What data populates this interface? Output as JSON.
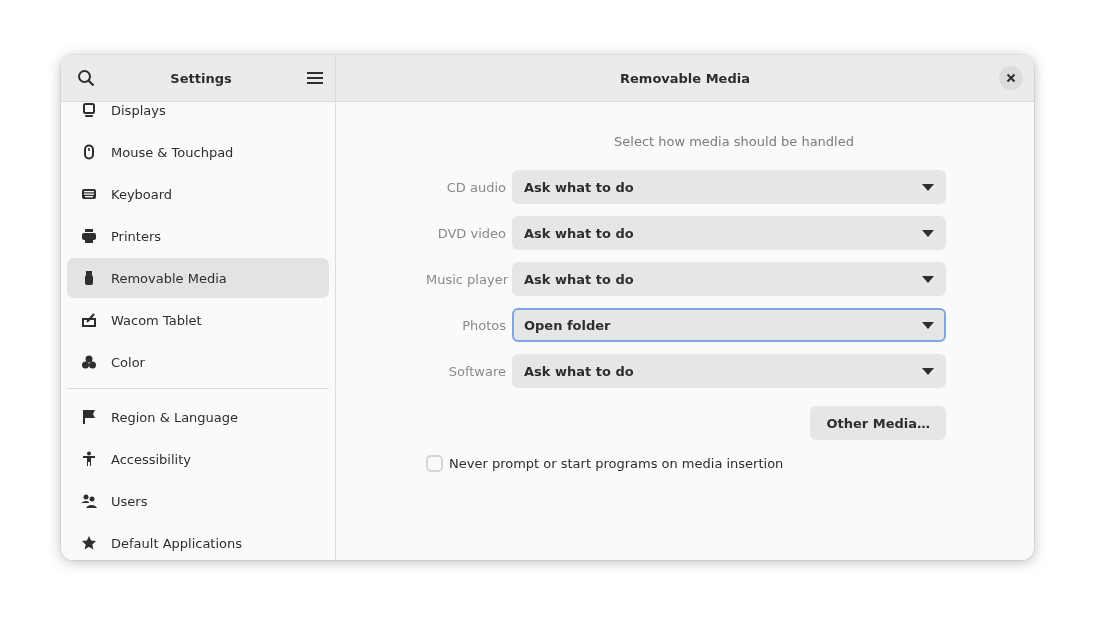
{
  "sidebar": {
    "title": "Settings",
    "groups": [
      {
        "items": [
          {
            "label": "Displays",
            "selected": false
          },
          {
            "label": "Mouse & Touchpad",
            "selected": false
          },
          {
            "label": "Keyboard",
            "selected": false
          },
          {
            "label": "Printers",
            "selected": false
          },
          {
            "label": "Removable Media",
            "selected": true
          },
          {
            "label": "Wacom Tablet",
            "selected": false
          },
          {
            "label": "Color",
            "selected": false
          }
        ]
      },
      {
        "items": [
          {
            "label": "Region & Language",
            "selected": false
          },
          {
            "label": "Accessibility",
            "selected": false
          },
          {
            "label": "Users",
            "selected": false
          },
          {
            "label": "Default Applications",
            "selected": false
          }
        ]
      }
    ]
  },
  "content": {
    "title": "Removable Media",
    "heading": "Select how media should be handled",
    "rows": [
      {
        "label": "CD audio",
        "value": "Ask what to do",
        "focused": false
      },
      {
        "label": "DVD video",
        "value": "Ask what to do",
        "focused": false
      },
      {
        "label": "Music player",
        "value": "Ask what to do",
        "focused": false
      },
      {
        "label": "Photos",
        "value": "Open folder",
        "focused": true
      },
      {
        "label": "Software",
        "value": "Ask what to do",
        "focused": false
      }
    ],
    "other_button": "Other Media…",
    "never_prompt": {
      "label": "Never prompt or start programs on media insertion",
      "checked": false
    }
  }
}
